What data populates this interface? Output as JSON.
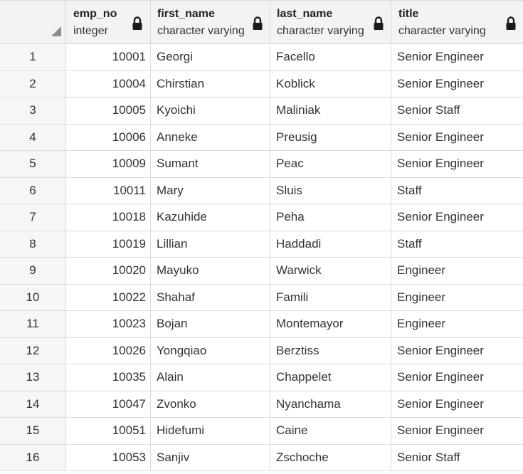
{
  "columns": [
    {
      "name": "emp_no",
      "type": "integer"
    },
    {
      "name": "first_name",
      "type": "character varying"
    },
    {
      "name": "last_name",
      "type": "character varying"
    },
    {
      "name": "title",
      "type": "character varying"
    }
  ],
  "rows": [
    {
      "n": "1",
      "emp_no": "10001",
      "first_name": "Georgi",
      "last_name": "Facello",
      "title": "Senior Engineer"
    },
    {
      "n": "2",
      "emp_no": "10004",
      "first_name": "Chirstian",
      "last_name": "Koblick",
      "title": "Senior Engineer"
    },
    {
      "n": "3",
      "emp_no": "10005",
      "first_name": "Kyoichi",
      "last_name": "Maliniak",
      "title": "Senior Staff"
    },
    {
      "n": "4",
      "emp_no": "10006",
      "first_name": "Anneke",
      "last_name": "Preusig",
      "title": "Senior Engineer"
    },
    {
      "n": "5",
      "emp_no": "10009",
      "first_name": "Sumant",
      "last_name": "Peac",
      "title": "Senior Engineer"
    },
    {
      "n": "6",
      "emp_no": "10011",
      "first_name": "Mary",
      "last_name": "Sluis",
      "title": "Staff"
    },
    {
      "n": "7",
      "emp_no": "10018",
      "first_name": "Kazuhide",
      "last_name": "Peha",
      "title": "Senior Engineer"
    },
    {
      "n": "8",
      "emp_no": "10019",
      "first_name": "Lillian",
      "last_name": "Haddadi",
      "title": "Staff"
    },
    {
      "n": "9",
      "emp_no": "10020",
      "first_name": "Mayuko",
      "last_name": "Warwick",
      "title": "Engineer"
    },
    {
      "n": "10",
      "emp_no": "10022",
      "first_name": "Shahaf",
      "last_name": "Famili",
      "title": "Engineer"
    },
    {
      "n": "11",
      "emp_no": "10023",
      "first_name": "Bojan",
      "last_name": "Montemayor",
      "title": "Engineer"
    },
    {
      "n": "12",
      "emp_no": "10026",
      "first_name": "Yongqiao",
      "last_name": "Berztiss",
      "title": "Senior Engineer"
    },
    {
      "n": "13",
      "emp_no": "10035",
      "first_name": "Alain",
      "last_name": "Chappelet",
      "title": "Senior Engineer"
    },
    {
      "n": "14",
      "emp_no": "10047",
      "first_name": "Zvonko",
      "last_name": "Nyanchama",
      "title": "Senior Engineer"
    },
    {
      "n": "15",
      "emp_no": "10051",
      "first_name": "Hidefumi",
      "last_name": "Caine",
      "title": "Senior Engineer"
    },
    {
      "n": "16",
      "emp_no": "10053",
      "first_name": "Sanjiv",
      "last_name": "Zschoche",
      "title": "Senior Staff"
    }
  ],
  "icons": {
    "lock": "lock-icon",
    "select_all": "select-all-triangle-icon"
  },
  "colors": {
    "header_bg": "#f3f3f3",
    "grid_line": "#dcdcdc",
    "text": "#333333"
  }
}
